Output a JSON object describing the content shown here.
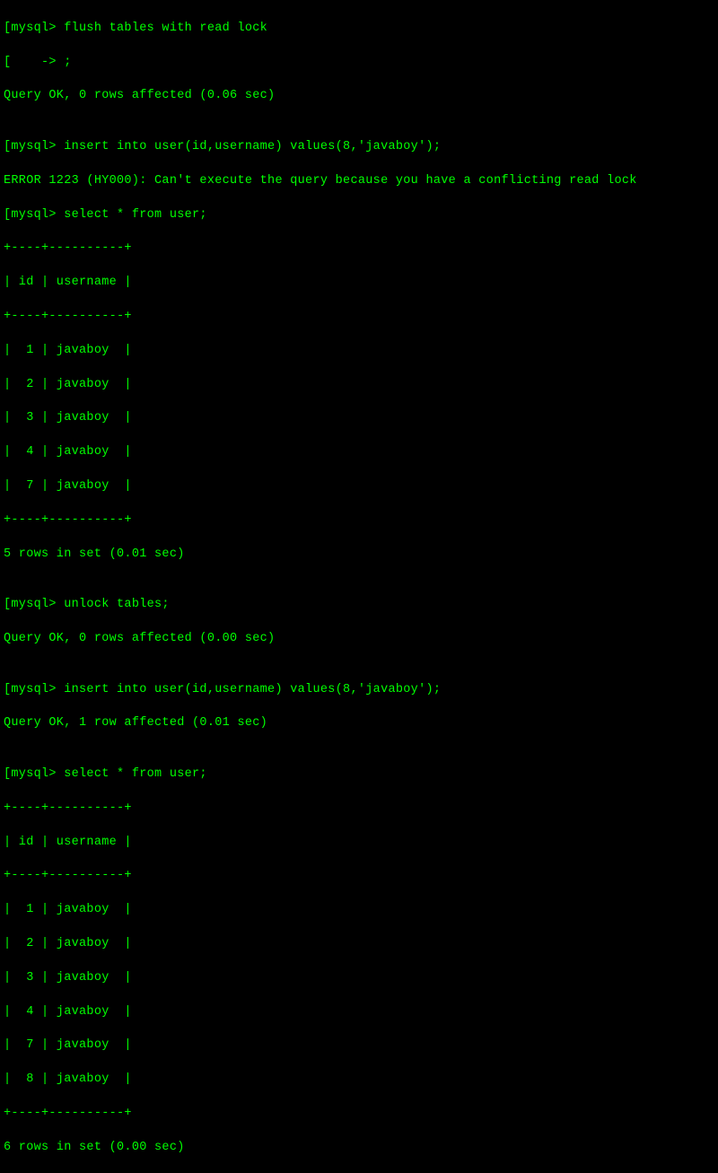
{
  "lines": [
    "[mysql> flush tables with read lock",
    "[    -> ;",
    "Query OK, 0 rows affected (0.06 sec)",
    "",
    "[mysql> insert into user(id,username) values(8,'javaboy');",
    "ERROR 1223 (HY000): Can't execute the query because you have a conflicting read lock",
    "[mysql> select * from user;",
    "+----+----------+",
    "| id | username |",
    "+----+----------+",
    "|  1 | javaboy  |",
    "|  2 | javaboy  |",
    "|  3 | javaboy  |",
    "|  4 | javaboy  |",
    "|  7 | javaboy  |",
    "+----+----------+",
    "5 rows in set (0.01 sec)",
    "",
    "[mysql> unlock tables;",
    "Query OK, 0 rows affected (0.00 sec)",
    "",
    "[mysql> insert into user(id,username) values(8,'javaboy');",
    "Query OK, 1 row affected (0.01 sec)",
    "",
    "[mysql> select * from user;",
    "+----+----------+",
    "| id | username |",
    "+----+----------+",
    "|  1 | javaboy  |",
    "|  2 | javaboy  |",
    "|  3 | javaboy  |",
    "|  4 | javaboy  |",
    "|  7 | javaboy  |",
    "|  8 | javaboy  |",
    "+----+----------+",
    "6 rows in set (0.00 sec)"
  ]
}
